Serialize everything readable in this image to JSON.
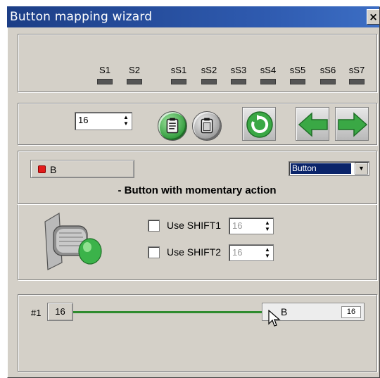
{
  "window": {
    "title": "Button mapping wizard",
    "close_label": "×"
  },
  "shift_indicators": [
    {
      "label": "S1"
    },
    {
      "label": "S2"
    },
    {
      "label": "sS1"
    },
    {
      "label": "sS2"
    },
    {
      "label": "sS3"
    },
    {
      "label": "sS4"
    },
    {
      "label": "sS5"
    },
    {
      "label": "sS6"
    },
    {
      "label": "sS7"
    }
  ],
  "toolbar": {
    "button_number": "16",
    "spin_up": "▲",
    "spin_down": "▼",
    "copy_icon": "clipboard-copy-icon",
    "paste_icon": "clipboard-paste-icon",
    "refresh_icon": "refresh-icon",
    "prev_icon": "arrow-left-icon",
    "next_icon": "arrow-right-icon",
    "accent_green": "#3aa845"
  },
  "button_config": {
    "name_label": "B",
    "type_value": "Button",
    "dropdown_arrow": "▼",
    "description": "- Button with momentary action"
  },
  "shift_options": [
    {
      "label": "Use SHIFT1",
      "value": "16",
      "checked": false
    },
    {
      "label": "Use SHIFT2",
      "value": "16",
      "checked": false
    }
  ],
  "mapping": {
    "row_label": "#1",
    "source_button": "16",
    "target_label": "B",
    "target_number": "16"
  }
}
